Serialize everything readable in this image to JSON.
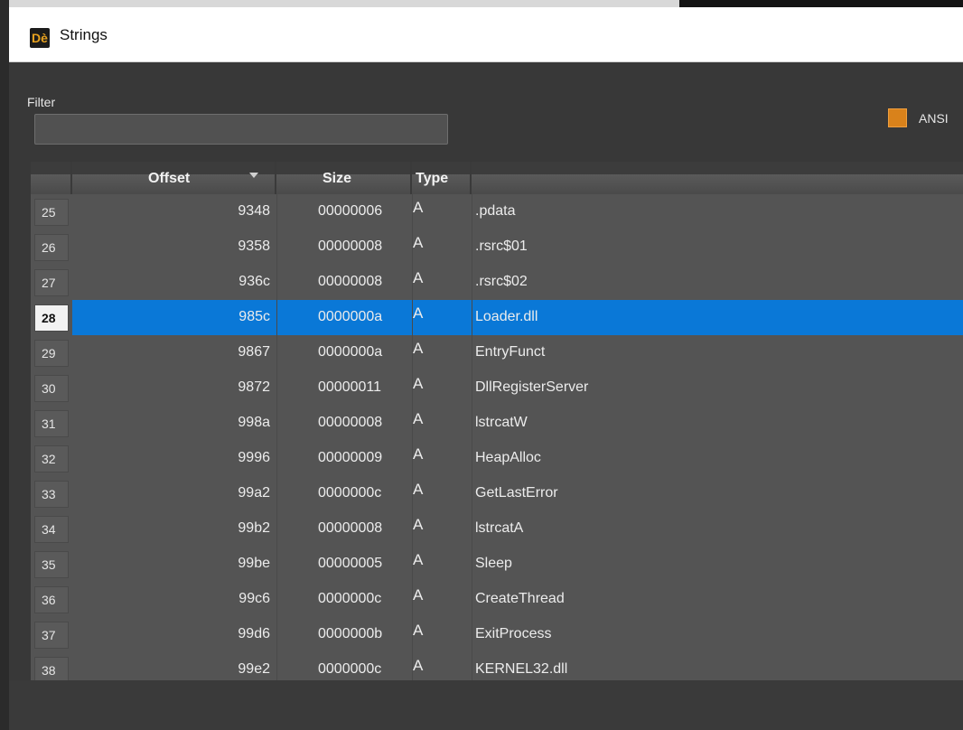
{
  "window": {
    "title": "Strings",
    "icon": "de-app-icon",
    "icon_glyph": "Dè"
  },
  "filter": {
    "label": "Filter",
    "value": ""
  },
  "ansi": {
    "label": "ANSI",
    "color": "#d9821b"
  },
  "table": {
    "columns": {
      "offset": "Offset",
      "size": "Size",
      "type": "Type"
    },
    "selected_index": 3,
    "rows": [
      {
        "num": "25",
        "offset": "9348",
        "size": "00000006",
        "type": "A",
        "name": ".pdata"
      },
      {
        "num": "26",
        "offset": "9358",
        "size": "00000008",
        "type": "A",
        "name": ".rsrc$01"
      },
      {
        "num": "27",
        "offset": "936c",
        "size": "00000008",
        "type": "A",
        "name": ".rsrc$02"
      },
      {
        "num": "28",
        "offset": "985c",
        "size": "0000000a",
        "type": "A",
        "name": "Loader.dll"
      },
      {
        "num": "29",
        "offset": "9867",
        "size": "0000000a",
        "type": "A",
        "name": "EntryFunct"
      },
      {
        "num": "30",
        "offset": "9872",
        "size": "00000011",
        "type": "A",
        "name": "DllRegisterServer"
      },
      {
        "num": "31",
        "offset": "998a",
        "size": "00000008",
        "type": "A",
        "name": "lstrcatW"
      },
      {
        "num": "32",
        "offset": "9996",
        "size": "00000009",
        "type": "A",
        "name": "HeapAlloc"
      },
      {
        "num": "33",
        "offset": "99a2",
        "size": "0000000c",
        "type": "A",
        "name": "GetLastError"
      },
      {
        "num": "34",
        "offset": "99b2",
        "size": "00000008",
        "type": "A",
        "name": "lstrcatA"
      },
      {
        "num": "35",
        "offset": "99be",
        "size": "00000005",
        "type": "A",
        "name": "Sleep"
      },
      {
        "num": "36",
        "offset": "99c6",
        "size": "0000000c",
        "type": "A",
        "name": "CreateThread"
      },
      {
        "num": "37",
        "offset": "99d6",
        "size": "0000000b",
        "type": "A",
        "name": "ExitProcess"
      },
      {
        "num": "38",
        "offset": "99e2",
        "size": "0000000c",
        "type": "A",
        "name": "KERNEL32.dll"
      }
    ]
  },
  "colors": {
    "selection": "#0a78d7",
    "background": "#383838"
  }
}
